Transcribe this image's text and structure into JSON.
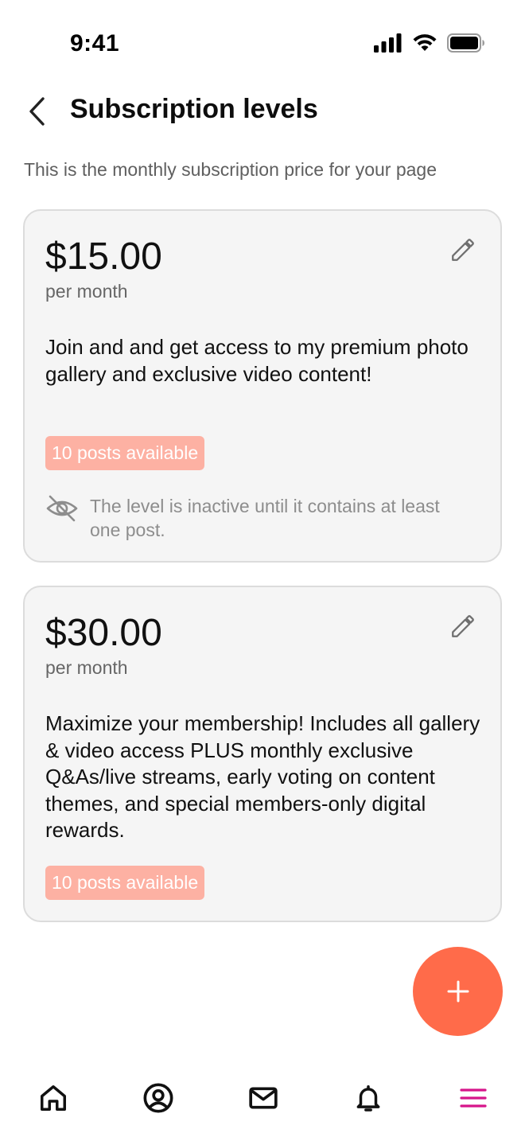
{
  "status_bar": {
    "time": "9:41"
  },
  "header": {
    "title": "Subscription levels"
  },
  "subtitle": "This is the monthly subscription price for your page",
  "levels": [
    {
      "price": "$15.00",
      "period": "per month",
      "description": "Join and and get access to my premium photo gallery and exclusive video content!",
      "posts_badge": "10 posts available",
      "inactive_note": "The level is inactive until it contains at least one post."
    },
    {
      "price": "$30.00",
      "period": "per month",
      "description": "Maximize your membership! Includes all gallery & video access PLUS monthly exclusive Q&As/live streams, early voting on content themes, and special members-only digital rewards.",
      "posts_badge": "10 posts available"
    }
  ],
  "colors": {
    "accent": "#ff6b4a",
    "badge": "#fdb1a3",
    "menu_active": "#d6158a",
    "card_bg": "#f5f5f5"
  },
  "icons": {
    "back": "chevron-left-icon",
    "edit": "pencil-icon",
    "inactive": "eye-off-icon",
    "add": "plus-icon",
    "nav": [
      "home-icon",
      "profile-icon",
      "mail-icon",
      "bell-icon",
      "menu-icon"
    ]
  }
}
